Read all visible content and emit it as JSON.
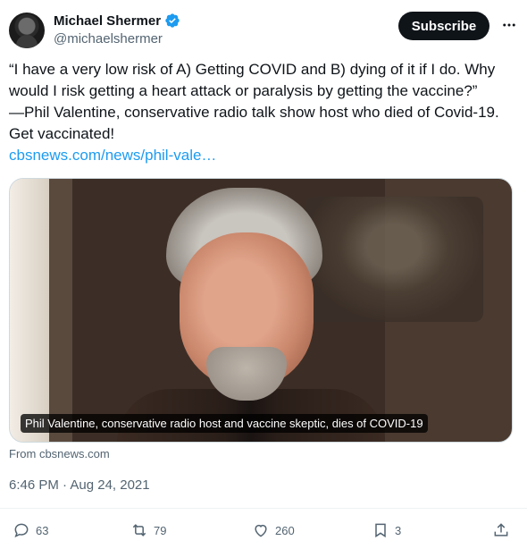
{
  "author": {
    "display_name": "Michael Shermer",
    "handle": "@michaelshermer",
    "avatar_icon": "user-avatar",
    "verified_icon": "verified-badge-icon",
    "verified_color": "#1d9bf0"
  },
  "header": {
    "subscribe_label": "Subscribe",
    "more_icon": "more-icon"
  },
  "tweet": {
    "lines": [
      "“I have a very low risk of A) Getting COVID and B) dying of it if I do. Why",
      "would I risk getting a heart attack or paralysis by getting the vaccine?”",
      "—Phil Valentine, conservative radio talk show host who died of Covid-19.",
      "Get vaccinated!"
    ],
    "link_text": "cbsnews.com/news/phil-vale…",
    "link_color": "#1d9bf0"
  },
  "media": {
    "caption": "Phil Valentine, conservative radio host and vaccine skeptic, dies of COVID-19",
    "source": "From cbsnews.com"
  },
  "timestamp": "6:46 PM · Aug 24, 2021",
  "actions": {
    "replies": "63",
    "retweets": "79",
    "likes": "260",
    "bookmarks": "3"
  },
  "colors": {
    "text_primary": "#0f1419",
    "text_secondary": "#536471",
    "accent": "#1d9bf0"
  }
}
